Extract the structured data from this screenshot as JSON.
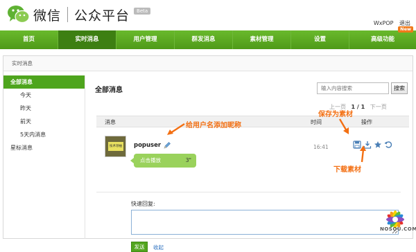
{
  "header": {
    "logo_text": "微信",
    "logo_sub": "公众平台",
    "beta_badge": "Beta",
    "username": "WxPOP",
    "logout": "退出"
  },
  "nav": {
    "items": [
      {
        "label": "首页"
      },
      {
        "label": "实时消息"
      },
      {
        "label": "用户管理"
      },
      {
        "label": "群发消息"
      },
      {
        "label": "素材管理"
      },
      {
        "label": "设置"
      },
      {
        "label": "高级功能"
      }
    ],
    "new_badge": "New",
    "active_index": 1,
    "accent_color": "#4ea51d"
  },
  "breadcrumb": "实时消息",
  "sidebar": {
    "items": [
      {
        "label": "全部消息"
      },
      {
        "label": "今天"
      },
      {
        "label": "昨天"
      },
      {
        "label": "前天"
      },
      {
        "label": "5天内消息"
      },
      {
        "label": "星标消息"
      }
    ]
  },
  "main": {
    "title": "全部消息",
    "search_placeholder": "输入内容搜索",
    "search_button": "搜索",
    "pager": {
      "prev": "上一页",
      "current": "1 / 1",
      "next": "下一页"
    },
    "columns": {
      "message": "消息",
      "time": "时间",
      "actions": "操作"
    },
    "message": {
      "nickname": "popuser",
      "avatar_text": "技术领袖",
      "voice_label": "点击播放",
      "voice_duration": "3\"",
      "time": "16:41"
    },
    "reply": {
      "label": "快速回复:",
      "value": "",
      "send_button": "发送",
      "collapse_link": "收起"
    }
  },
  "annotations": {
    "edit_nickname": "给用户名添加昵称",
    "save_as_material": "保存为素材",
    "download_material": "下载素材",
    "color": "#f36f12"
  },
  "watermark": "NOSOU.COM",
  "icons": {
    "edit": "pencil-icon",
    "save": "floppy-disk-icon",
    "download": "download-icon",
    "star": "star-icon",
    "reply": "reply-arrow-icon"
  }
}
